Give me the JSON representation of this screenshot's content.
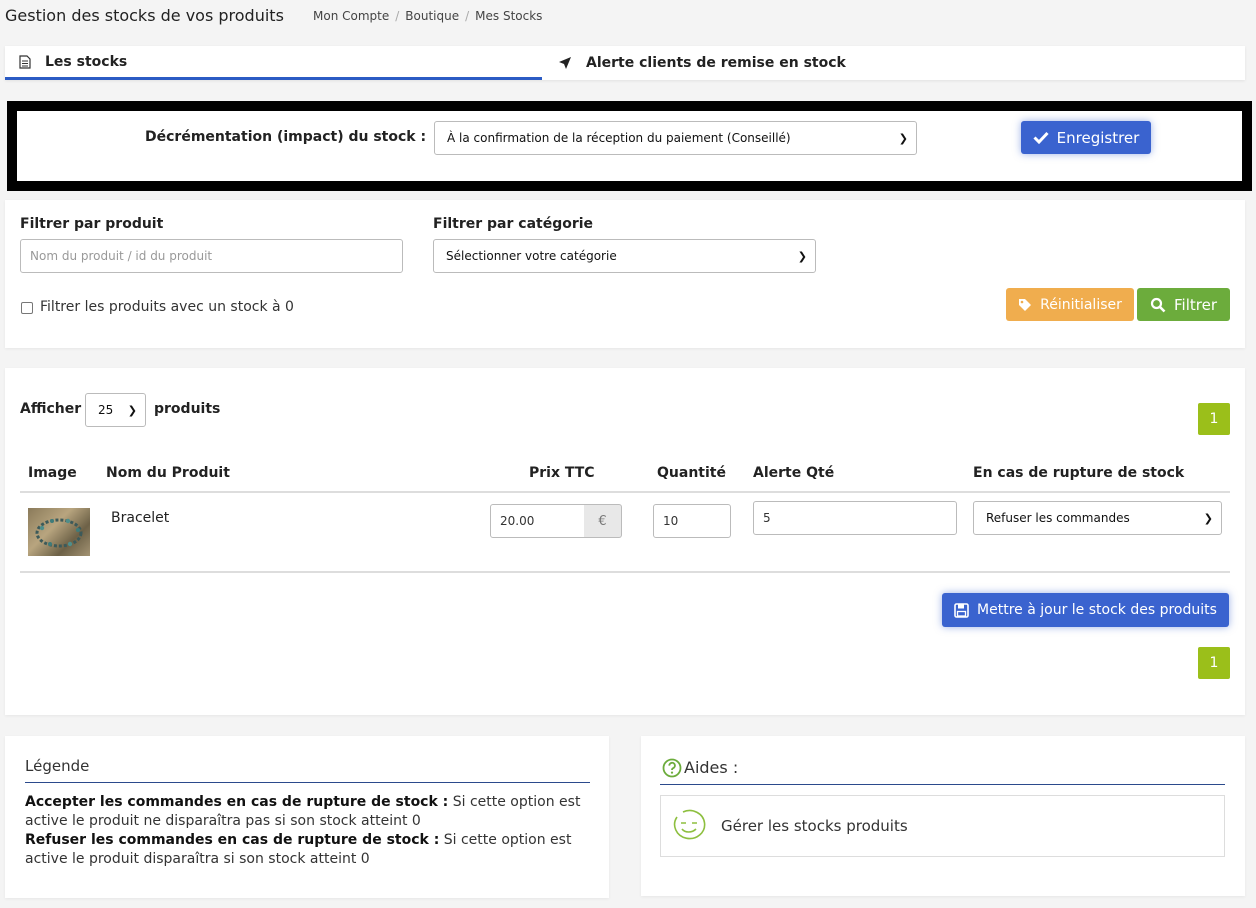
{
  "header": {
    "title": "Gestion des stocks de vos produits",
    "breadcrumb": [
      "Mon Compte",
      "Boutique",
      "Mes Stocks"
    ]
  },
  "tabs": [
    {
      "label": "Les stocks",
      "active": true
    },
    {
      "label": "Alerte clients de remise en stock",
      "active": false
    }
  ],
  "decrement": {
    "label": "Décrémentation (impact) du stock :",
    "selected": "À la confirmation de la réception du paiement (Conseillé)",
    "save_label": "Enregistrer"
  },
  "filters": {
    "product_label": "Filtrer par produit",
    "product_placeholder": "Nom du produit / id du produit",
    "category_label": "Filtrer par catégorie",
    "category_selected": "Sélectionner votre catégorie",
    "zero_stock_label": "Filtrer les produits avec un stock à 0",
    "reset_label": "Réinitialiser",
    "filter_label": "Filtrer"
  },
  "list": {
    "show_label": "Afficher",
    "per_page": "25",
    "products_label": "produits",
    "page": "1",
    "columns": [
      "Image",
      "Nom du Produit",
      "Prix TTC",
      "Quantité",
      "Alerte Qté",
      "En cas de rupture de stock"
    ],
    "rows": [
      {
        "name": "Bracelet",
        "price": "20.00",
        "currency": "€",
        "quantity": "10",
        "alert_qty": "5",
        "stockout": "Refuser les commandes"
      }
    ],
    "update_label": "Mettre à jour le stock des produits"
  },
  "legend": {
    "title": "Légende",
    "accept_title": "Accepter les commandes en cas de rupture de stock :",
    "accept_text": " Si cette option est active le produit ne disparaîtra pas si son stock atteint 0",
    "refuse_title": "Refuser les commandes en cas de rupture de stock :",
    "refuse_text": " Si cette option est active le produit disparaîtra si son stock atteint 0"
  },
  "help": {
    "title": "Aides :",
    "items": [
      {
        "label": "Gérer les stocks produits"
      }
    ]
  },
  "colors": {
    "primary": "#3a63cf",
    "success": "#6cac3c",
    "warning": "#f0ad4e",
    "pager": "#9bbf1a"
  }
}
